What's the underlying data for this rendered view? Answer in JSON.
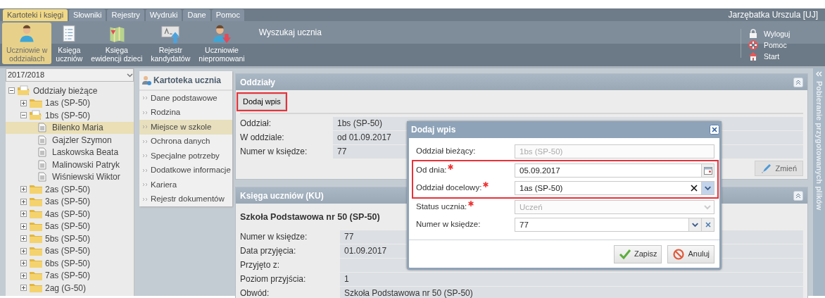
{
  "menu_tabs": [
    {
      "label": "Kartoteki i księgi",
      "selected": true
    },
    {
      "label": "Słowniki",
      "selected": false
    },
    {
      "label": "Rejestry",
      "selected": false
    },
    {
      "label": "Wydruki",
      "selected": false
    },
    {
      "label": "Dane",
      "selected": false
    },
    {
      "label": "Pomoc",
      "selected": false
    }
  ],
  "user": "Jarzębatka Urszula [UJ]",
  "ribbon": [
    {
      "kind": "student",
      "label": "Uczniowie w\noddziałach",
      "selected": true
    },
    {
      "kind": "book",
      "label": "Księga\nuczniów",
      "selected": false
    },
    {
      "kind": "map",
      "label": "Księga\newidencji dzieci",
      "selected": false
    },
    {
      "kind": "register",
      "label": "Rejestr\nkandydatów",
      "selected": false
    },
    {
      "kind": "unpromoted",
      "label": "Uczniowie\nniepromowani",
      "selected": false
    }
  ],
  "search_label": "Wyszukaj ucznia",
  "quick_links": [
    {
      "kind": "logout",
      "label": "Wyloguj"
    },
    {
      "kind": "help",
      "label": "Pomoc"
    },
    {
      "kind": "home",
      "label": "Start"
    }
  ],
  "year_select": "2017/2018",
  "tree": [
    {
      "kind": "folder",
      "label": "Oddziały bieżące",
      "expanded": true,
      "selected": false,
      "children": [
        {
          "kind": "folder",
          "label": "1as (SP-50)",
          "expanded": false,
          "selected": false
        },
        {
          "kind": "folder",
          "label": "1bs (SP-50)",
          "expanded": true,
          "selected": false,
          "children": [
            {
              "kind": "student",
              "label": "Bilenko Maria",
              "selected": true
            },
            {
              "kind": "student",
              "label": "Gajzler Szymon",
              "selected": false
            },
            {
              "kind": "student",
              "label": "Laskowska Beata",
              "selected": false
            },
            {
              "kind": "student",
              "label": "Malinowski Patryk",
              "selected": false
            },
            {
              "kind": "student",
              "label": "Wiśniewski Wiktor",
              "selected": false
            }
          ]
        },
        {
          "kind": "folder",
          "label": "2as (SP-50)",
          "expanded": false,
          "selected": false
        },
        {
          "kind": "folder",
          "label": "3as (SP-50)",
          "expanded": false,
          "selected": false
        },
        {
          "kind": "folder",
          "label": "4as (SP-50)",
          "expanded": false,
          "selected": false
        },
        {
          "kind": "folder",
          "label": "5as (SP-50)",
          "expanded": false,
          "selected": false
        },
        {
          "kind": "folder",
          "label": "5bs (SP-50)",
          "expanded": false,
          "selected": false
        },
        {
          "kind": "folder",
          "label": "6as (SP-50)",
          "expanded": false,
          "selected": false
        },
        {
          "kind": "folder",
          "label": "6bs (SP-50)",
          "expanded": false,
          "selected": false
        },
        {
          "kind": "folder",
          "label": "7as (SP-50)",
          "expanded": false,
          "selected": false
        },
        {
          "kind": "folder",
          "label": "2ag (G-50)",
          "expanded": false,
          "selected": false
        }
      ]
    }
  ],
  "student_menu": {
    "title": "Kartoteka ucznia",
    "items": [
      {
        "label": "Dane podstawowe",
        "selected": false
      },
      {
        "label": "Rodzina",
        "selected": false
      },
      {
        "label": "Miejsce w szkole",
        "selected": true
      },
      {
        "label": "Ochrona danych",
        "selected": false
      },
      {
        "label": "Specjalne potrzeby",
        "selected": false
      },
      {
        "label": "Dodatkowe informacje",
        "selected": false
      },
      {
        "label": "Kariera",
        "selected": false
      },
      {
        "label": "Rejestr dokumentów",
        "selected": false
      }
    ]
  },
  "classes_panel": {
    "title": "Oddziały",
    "add_button": {
      "label": "Dodaj wpis",
      "highlighted": true
    },
    "fields": [
      {
        "label": "Oddział:",
        "value": "1bs (SP-50)"
      },
      {
        "label": "W oddziale:",
        "value": "od 01.09.2017"
      },
      {
        "label": "Numer w księdze:",
        "value": "77"
      }
    ],
    "edit_button": "Zmień"
  },
  "register_panel": {
    "title": "Księga uczniów (KU)",
    "school": "Szkoła Podstawowa nr 50 (SP-50)",
    "fields": [
      {
        "label": "Numer w księdze:",
        "value": "77"
      },
      {
        "label": "Data przyjęcia:",
        "value": "01.09.2017"
      },
      {
        "label": "Przyjęto z:"
      },
      {
        "label": "Poziom przyjścia:",
        "value": "1"
      },
      {
        "label": "Obwód:",
        "value": "Szkoła Podstawowa nr 50 (SP-50)"
      }
    ]
  },
  "side_panel": "Pobieranie przygotowanych plików",
  "dialog": {
    "title": "Dodaj wpis",
    "fields": [
      {
        "kind": "text",
        "label": "Oddział bieżący:",
        "value": "1bs (SP-50)",
        "required": false,
        "disabled": true,
        "highlighted": false
      },
      {
        "kind": "date",
        "label": "Od dnia:",
        "value": "05.09.2017",
        "required": true,
        "disabled": false,
        "highlighted": true
      },
      {
        "kind": "combo",
        "label": "Oddział docelowy:",
        "value": "1as (SP-50)",
        "required": true,
        "disabled": false,
        "highlighted": true
      },
      {
        "kind": "select",
        "label": "Status ucznia:",
        "value": "Uczeń",
        "required": true,
        "disabled": true,
        "highlighted": false
      },
      {
        "kind": "number",
        "label": "Numer w księdze:",
        "value": "77",
        "required": false,
        "disabled": false,
        "highlighted": false
      }
    ],
    "buttons": [
      {
        "kind": "save",
        "label": "Zapisz"
      },
      {
        "kind": "cancel",
        "label": "Anuluj"
      }
    ]
  }
}
